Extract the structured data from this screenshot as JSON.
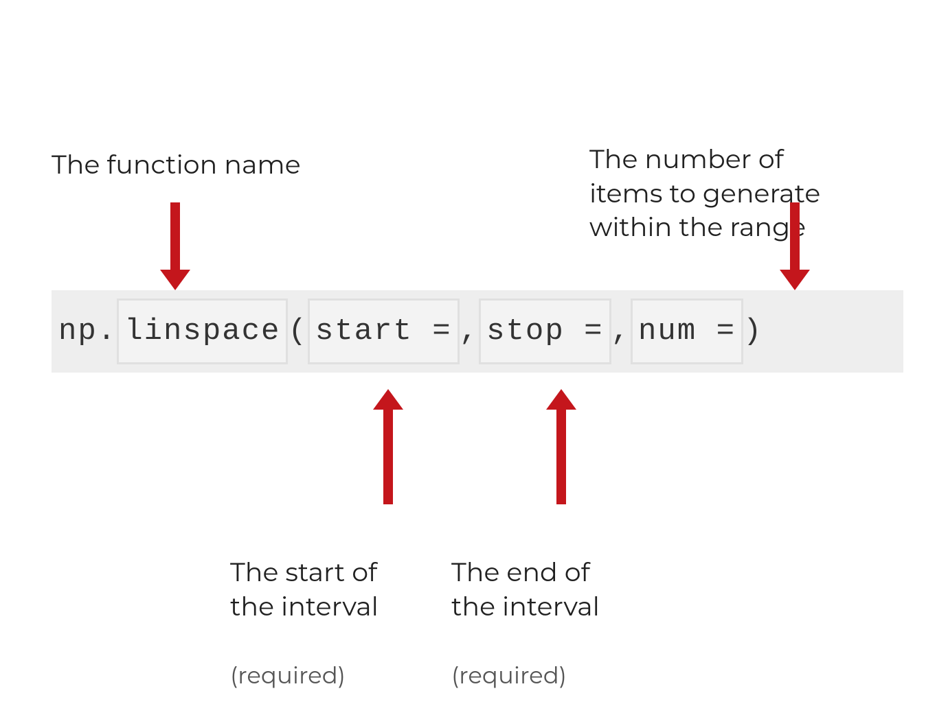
{
  "labels": {
    "function_name": "The function name",
    "num_items": "The number of\nitems to generate\nwithin the range",
    "start_interval": "The start of\nthe interval",
    "start_required": "(required)",
    "end_interval": "The end of\nthe interval",
    "end_required": "(required)"
  },
  "code": {
    "prefix": "np.",
    "func": "linspace",
    "open_paren": "(",
    "start_kw": "start = ",
    "comma1": ", ",
    "stop_kw": "stop =",
    "comma2": ", ",
    "num_kw": "num = ",
    "close_paren": ")"
  },
  "colors": {
    "arrow": "#c4161c",
    "code_bg": "#eeeeee",
    "box_border": "#e0e0e0"
  }
}
